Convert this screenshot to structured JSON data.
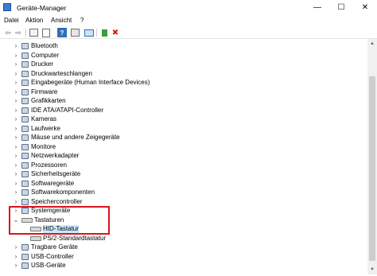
{
  "window": {
    "title": "Geräte-Manager",
    "min_glyph": "—",
    "max_glyph": "☐",
    "close_glyph": "✕"
  },
  "menu": [
    {
      "label": "Datei"
    },
    {
      "label": "Aktion"
    },
    {
      "label": "Ansicht"
    },
    {
      "label": "?"
    }
  ],
  "toolbar": {
    "icons": [
      "back-arrow-icon",
      "forward-arrow-icon",
      "properties-icon",
      "update-driver-icon",
      "help-icon",
      "device-list-icon",
      "scan-hardware-icon",
      "add-device-icon",
      "uninstall-icon"
    ],
    "back_glyph": "⇦",
    "forward_glyph": "⇨",
    "help_glyph": "?",
    "uninstall_glyph": "✖"
  },
  "tree": {
    "expand_glyph": "›",
    "collapse_glyph": "⌄",
    "items": [
      {
        "label": "Bluetooth",
        "state": "collapsed",
        "icon": "bluetooth-icon"
      },
      {
        "label": "Computer",
        "state": "collapsed",
        "icon": "computer-icon"
      },
      {
        "label": "Drucker",
        "state": "collapsed",
        "icon": "printer-icon"
      },
      {
        "label": "Druckwarteschlangen",
        "state": "collapsed",
        "icon": "print-queue-icon"
      },
      {
        "label": "Eingabegeräte (Human Interface Devices)",
        "state": "collapsed",
        "icon": "hid-icon"
      },
      {
        "label": "Firmware",
        "state": "collapsed",
        "icon": "firmware-icon"
      },
      {
        "label": "Grafikkarten",
        "state": "collapsed",
        "icon": "display-adapter-icon"
      },
      {
        "label": "IDE ATA/ATAPI-Controller",
        "state": "collapsed",
        "icon": "ide-controller-icon"
      },
      {
        "label": "Kameras",
        "state": "collapsed",
        "icon": "camera-icon"
      },
      {
        "label": "Laufwerke",
        "state": "collapsed",
        "icon": "disk-drive-icon"
      },
      {
        "label": "Mäuse und andere Zeigegeräte",
        "state": "collapsed",
        "icon": "mouse-icon"
      },
      {
        "label": "Monitore",
        "state": "collapsed",
        "icon": "monitor-icon"
      },
      {
        "label": "Netzwerkadapter",
        "state": "collapsed",
        "icon": "network-adapter-icon"
      },
      {
        "label": "Prozessoren",
        "state": "collapsed",
        "icon": "processor-icon"
      },
      {
        "label": "Sicherheitsgeräte",
        "state": "collapsed",
        "icon": "security-device-icon"
      },
      {
        "label": "Softwaregeräte",
        "state": "collapsed",
        "icon": "software-device-icon"
      },
      {
        "label": "Softwarekomponenten",
        "state": "collapsed",
        "icon": "software-component-icon"
      },
      {
        "label": "Speichercontroller",
        "state": "collapsed",
        "icon": "storage-controller-icon"
      },
      {
        "label": "Systemgeräte",
        "state": "collapsed",
        "icon": "system-device-icon"
      },
      {
        "label": "Tastaturen",
        "state": "expanded",
        "icon": "keyboard-icon"
      },
      {
        "label": "HID-Tastatur",
        "state": "child",
        "selected": true,
        "icon": "keyboard-icon"
      },
      {
        "label": "PS/2-Standardtastatur",
        "state": "child",
        "icon": "keyboard-icon"
      },
      {
        "label": "Tragbare Geräte",
        "state": "collapsed",
        "icon": "portable-device-icon"
      },
      {
        "label": "USB-Controller",
        "state": "collapsed",
        "icon": "usb-controller-icon"
      },
      {
        "label": "USB-Geräte",
        "state": "collapsed",
        "icon": "usb-device-icon"
      }
    ]
  },
  "annotation": {
    "color": "#d9151c"
  }
}
